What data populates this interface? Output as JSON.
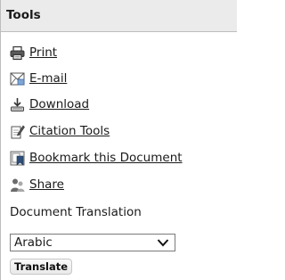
{
  "panel": {
    "title": "Tools"
  },
  "tools": [
    {
      "label": "Print",
      "icon": "printer-icon"
    },
    {
      "label": "E-mail",
      "icon": "email-icon"
    },
    {
      "label": "Download",
      "icon": "download-icon"
    },
    {
      "label": "Citation Tools",
      "icon": "citation-icon"
    },
    {
      "label": "Bookmark this Document",
      "icon": "bookmark-icon"
    },
    {
      "label": "Share",
      "icon": "share-icon"
    }
  ],
  "translation": {
    "label": "Document Translation",
    "selected_language": "Arabic",
    "button_label": "Translate"
  }
}
